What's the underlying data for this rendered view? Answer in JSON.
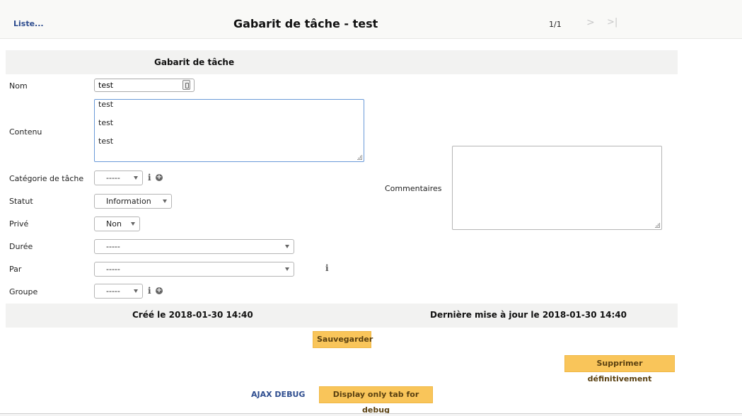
{
  "header": {
    "back_link": "Liste...",
    "title": "Gabarit de tâche - test",
    "pager": "1/1",
    "next_glyph": ">",
    "last_glyph": ">|"
  },
  "section": {
    "title": "Gabarit de tâche"
  },
  "form": {
    "nom_label": "Nom",
    "nom_value": "test",
    "contenu_label": "Contenu",
    "contenu_lines": [
      "test",
      "test",
      "test"
    ],
    "categorie_label": "Catégorie de tâche",
    "categorie_value": "-----",
    "statut_label": "Statut",
    "statut_value": "Information",
    "prive_label": "Privé",
    "prive_value": "Non",
    "duree_label": "Durée",
    "duree_value": "-----",
    "par_label": "Par",
    "par_value": "-----",
    "groupe_label": "Groupe",
    "groupe_value": "-----",
    "commentaires_label": "Commentaires",
    "commentaires_value": ""
  },
  "footer": {
    "created": "Créé le 2018-01-30 14:40",
    "updated": "Dernière mise à jour le 2018-01-30 14:40"
  },
  "actions": {
    "save": "Sauvegarder",
    "delete": "Supprimer définitivement",
    "ajax_debug": "AJAX DEBUG",
    "debug_tab": "Display only tab for debug"
  },
  "icons": {
    "info": "i",
    "plus": "+"
  },
  "colors": {
    "accent_link": "#2e4d8f",
    "button": "#f9c55a",
    "header_band": "#f2f2f1"
  }
}
